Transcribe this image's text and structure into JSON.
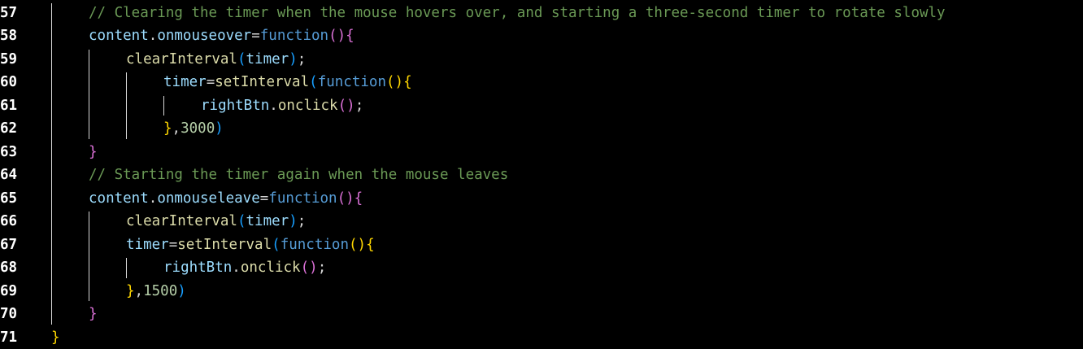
{
  "editor": {
    "lines": [
      {
        "number": "57",
        "indent": 1,
        "tokens": [
          {
            "text": "// Clearing the timer when the mouse hovers over, and starting a three-second timer to rotate slowly",
            "type": "com"
          }
        ]
      },
      {
        "number": "58",
        "indent": 1,
        "tokens": [
          {
            "text": "content",
            "type": "var"
          },
          {
            "text": ".",
            "type": "pun"
          },
          {
            "text": "onmouseover",
            "type": "var"
          },
          {
            "text": "=",
            "type": "pun"
          },
          {
            "text": "function",
            "type": "kw"
          },
          {
            "text": "()",
            "type": "b-m"
          },
          {
            "text": "{",
            "type": "b-m"
          }
        ]
      },
      {
        "number": "59",
        "indent": 2,
        "tokens": [
          {
            "text": "clearInterval",
            "type": "fn"
          },
          {
            "text": "(",
            "type": "b-b"
          },
          {
            "text": "timer",
            "type": "var"
          },
          {
            "text": ")",
            "type": "b-b"
          },
          {
            "text": ";",
            "type": "pun"
          }
        ]
      },
      {
        "number": "60",
        "indent": 3,
        "tokens": [
          {
            "text": "timer",
            "type": "var"
          },
          {
            "text": "=",
            "type": "pun"
          },
          {
            "text": "setInterval",
            "type": "fn"
          },
          {
            "text": "(",
            "type": "b-b"
          },
          {
            "text": "function",
            "type": "kw"
          },
          {
            "text": "()",
            "type": "b-y"
          },
          {
            "text": "{",
            "type": "b-y"
          }
        ]
      },
      {
        "number": "61",
        "indent": 4,
        "tokens": [
          {
            "text": "rightBtn",
            "type": "var"
          },
          {
            "text": ".",
            "type": "pun"
          },
          {
            "text": "onclick",
            "type": "fn"
          },
          {
            "text": "()",
            "type": "b-m"
          },
          {
            "text": ";",
            "type": "pun"
          }
        ]
      },
      {
        "number": "62",
        "indent": 3,
        "tokens": [
          {
            "text": "}",
            "type": "b-y"
          },
          {
            "text": ",",
            "type": "pun"
          },
          {
            "text": "3000",
            "type": "num"
          },
          {
            "text": ")",
            "type": "b-b"
          }
        ]
      },
      {
        "number": "63",
        "indent": 1,
        "tokens": [
          {
            "text": "}",
            "type": "b-m"
          }
        ]
      },
      {
        "number": "64",
        "indent": 1,
        "tokens": [
          {
            "text": "// Starting the timer again when the mouse leaves",
            "type": "com"
          }
        ]
      },
      {
        "number": "65",
        "indent": 1,
        "tokens": [
          {
            "text": "content",
            "type": "var"
          },
          {
            "text": ".",
            "type": "pun"
          },
          {
            "text": "onmouseleave",
            "type": "var"
          },
          {
            "text": "=",
            "type": "pun"
          },
          {
            "text": "function",
            "type": "kw"
          },
          {
            "text": "()",
            "type": "b-m"
          },
          {
            "text": "{",
            "type": "b-m"
          }
        ]
      },
      {
        "number": "66",
        "indent": 2,
        "tokens": [
          {
            "text": "clearInterval",
            "type": "fn"
          },
          {
            "text": "(",
            "type": "b-b"
          },
          {
            "text": "timer",
            "type": "var"
          },
          {
            "text": ")",
            "type": "b-b"
          },
          {
            "text": ";",
            "type": "pun"
          }
        ]
      },
      {
        "number": "67",
        "indent": 2,
        "tokens": [
          {
            "text": "timer",
            "type": "var"
          },
          {
            "text": "=",
            "type": "pun"
          },
          {
            "text": "setInterval",
            "type": "fn"
          },
          {
            "text": "(",
            "type": "b-b"
          },
          {
            "text": "function",
            "type": "kw"
          },
          {
            "text": "()",
            "type": "b-y"
          },
          {
            "text": "{",
            "type": "b-y"
          }
        ]
      },
      {
        "number": "68",
        "indent": 3,
        "tokens": [
          {
            "text": "rightBtn",
            "type": "var"
          },
          {
            "text": ".",
            "type": "pun"
          },
          {
            "text": "onclick",
            "type": "fn"
          },
          {
            "text": "()",
            "type": "b-m"
          },
          {
            "text": ";",
            "type": "pun"
          }
        ]
      },
      {
        "number": "69",
        "indent": 2,
        "tokens": [
          {
            "text": "}",
            "type": "b-y"
          },
          {
            "text": ",",
            "type": "pun"
          },
          {
            "text": "1500",
            "type": "num"
          },
          {
            "text": ")",
            "type": "b-b"
          }
        ]
      },
      {
        "number": "70",
        "indent": 1,
        "tokens": [
          {
            "text": "}",
            "type": "b-m"
          }
        ]
      },
      {
        "number": "71",
        "indent": 0,
        "tokens": [
          {
            "text": "}",
            "type": "b-y"
          }
        ]
      }
    ]
  }
}
